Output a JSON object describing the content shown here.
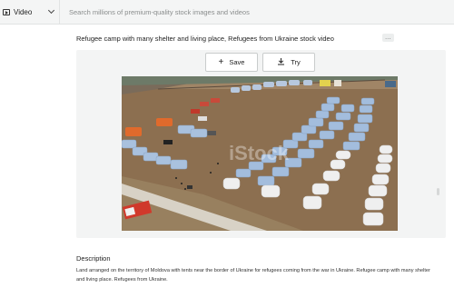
{
  "topbar": {
    "media_type": "Video",
    "media_icon": "video-icon",
    "search_placeholder": "Search millions of premium-quality stock images and videos"
  },
  "asset": {
    "title": "Refugee camp with many shelter and living place, Refugees from Ukraine stock video",
    "more_label": "...",
    "watermark": "iStock"
  },
  "actions": {
    "save_label": "Save",
    "save_icon": "plus-icon",
    "try_label": "Try",
    "try_icon": "download-icon"
  },
  "description": {
    "heading": "Description",
    "text": "Land arranged on the territory of Moldova with tents near the border of Ukraine for refugees coming from the war in Ukraine. Refugee camp with many shelter and living place. Refugees from Ukraine."
  },
  "colors": {
    "topbar_bg": "#f4f5f5",
    "panel_bg": "#f3f4f4",
    "tent_blue": "#a8c0dc",
    "tent_white": "#eeeeee",
    "tent_orange": "#e06a2c",
    "ground": "#8a6d4f"
  }
}
